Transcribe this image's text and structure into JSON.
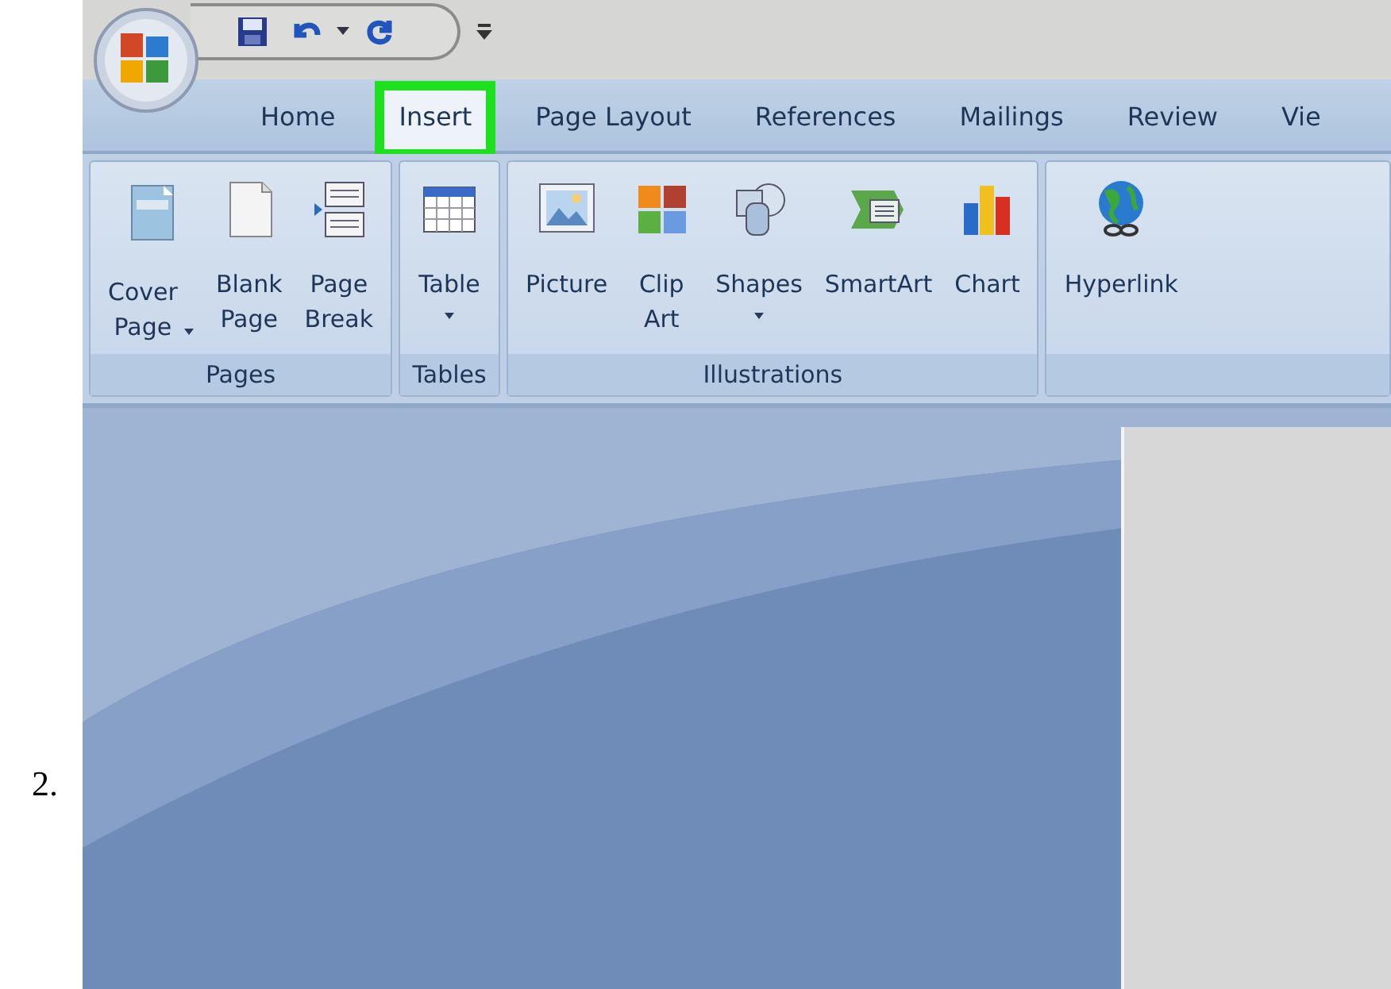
{
  "step_number": "2.",
  "tabs": [
    {
      "label": "Home",
      "selected": false,
      "highlighted": false
    },
    {
      "label": "Insert",
      "selected": true,
      "highlighted": true
    },
    {
      "label": "Page Layout",
      "selected": false,
      "highlighted": false
    },
    {
      "label": "References",
      "selected": false,
      "highlighted": false
    },
    {
      "label": "Mailings",
      "selected": false,
      "highlighted": false
    },
    {
      "label": "Review",
      "selected": false,
      "highlighted": false
    },
    {
      "label": "Vie",
      "selected": false,
      "highlighted": false
    }
  ],
  "groups": [
    {
      "label": "Pages",
      "buttons": [
        {
          "kind": "cover",
          "label": "Cover\nPage",
          "dropdown": true,
          "caret_beside_label": true
        },
        {
          "kind": "blank",
          "label": "Blank\nPage"
        },
        {
          "kind": "break",
          "label": "Page\nBreak"
        }
      ]
    },
    {
      "label": "Tables",
      "buttons": [
        {
          "kind": "table",
          "label": "Table",
          "dropdown": true
        }
      ]
    },
    {
      "label": "Illustrations",
      "buttons": [
        {
          "kind": "picture",
          "label": "Picture"
        },
        {
          "kind": "clipart",
          "label": "Clip\nArt"
        },
        {
          "kind": "shapes",
          "label": "Shapes",
          "dropdown": true
        },
        {
          "kind": "smartart",
          "label": "SmartArt"
        },
        {
          "kind": "chart",
          "label": "Chart"
        }
      ]
    },
    {
      "buttons": [
        {
          "kind": "hyperlink",
          "label": "Hyperlink"
        }
      ]
    }
  ]
}
